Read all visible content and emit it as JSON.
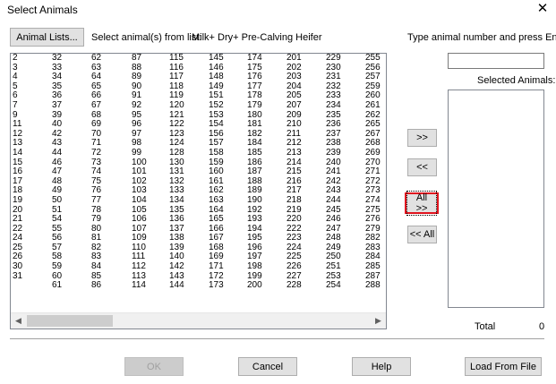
{
  "window": {
    "title": "Select Animals",
    "close_glyph": "✕"
  },
  "toolbar": {
    "animal_lists_label": "Animal Lists...",
    "instruction": "Select animal(s) from list:",
    "list_name": "Milk+ Dry+ Pre-Calving Heifer",
    "type_prompt": "Type animal number and press Enter"
  },
  "list": {
    "columns": [
      [
        "2",
        "3",
        "4",
        "5",
        "6",
        "7",
        "9",
        "11",
        "12",
        "13",
        "14",
        "15",
        "16",
        "17",
        "18",
        "19",
        "20",
        "21",
        "22",
        "24",
        "25",
        "26",
        "30",
        "31"
      ],
      [
        "32",
        "33",
        "34",
        "35",
        "36",
        "37",
        "39",
        "40",
        "42",
        "43",
        "44",
        "46",
        "47",
        "48",
        "49",
        "50",
        "51",
        "54",
        "55",
        "56",
        "57",
        "58",
        "59",
        "60",
        "61"
      ],
      [
        "62",
        "63",
        "64",
        "65",
        "66",
        "67",
        "68",
        "69",
        "70",
        "71",
        "72",
        "73",
        "74",
        "75",
        "76",
        "77",
        "78",
        "79",
        "80",
        "81",
        "82",
        "83",
        "84",
        "85",
        "86"
      ],
      [
        "87",
        "88",
        "89",
        "90",
        "91",
        "92",
        "95",
        "96",
        "97",
        "98",
        "99",
        "100",
        "101",
        "102",
        "103",
        "104",
        "105",
        "106",
        "107",
        "109",
        "110",
        "111",
        "112",
        "113",
        "114"
      ],
      [
        "115",
        "116",
        "117",
        "118",
        "119",
        "120",
        "121",
        "122",
        "123",
        "124",
        "128",
        "130",
        "131",
        "132",
        "133",
        "134",
        "135",
        "136",
        "137",
        "138",
        "139",
        "140",
        "142",
        "143",
        "144"
      ],
      [
        "145",
        "146",
        "148",
        "149",
        "151",
        "152",
        "153",
        "154",
        "156",
        "157",
        "158",
        "159",
        "160",
        "161",
        "162",
        "163",
        "164",
        "165",
        "166",
        "167",
        "168",
        "169",
        "171",
        "172",
        "173"
      ],
      [
        "174",
        "175",
        "176",
        "177",
        "178",
        "179",
        "180",
        "181",
        "182",
        "184",
        "185",
        "186",
        "187",
        "188",
        "189",
        "190",
        "192",
        "193",
        "194",
        "195",
        "196",
        "197",
        "198",
        "199",
        "200"
      ],
      [
        "201",
        "202",
        "203",
        "204",
        "205",
        "207",
        "209",
        "210",
        "211",
        "212",
        "213",
        "214",
        "215",
        "216",
        "217",
        "218",
        "219",
        "220",
        "222",
        "223",
        "224",
        "225",
        "226",
        "227",
        "228"
      ],
      [
        "229",
        "230",
        "231",
        "232",
        "233",
        "234",
        "235",
        "236",
        "237",
        "238",
        "239",
        "240",
        "241",
        "242",
        "243",
        "244",
        "245",
        "246",
        "247",
        "248",
        "249",
        "250",
        "251",
        "253",
        "254"
      ],
      [
        "255",
        "256",
        "257",
        "259",
        "260",
        "261",
        "262",
        "265",
        "267",
        "268",
        "269",
        "270",
        "271",
        "272",
        "273",
        "274",
        "275",
        "276",
        "279",
        "282",
        "283",
        "284",
        "285",
        "287",
        "288"
      ]
    ],
    "scroll_left_glyph": "◀",
    "scroll_right_glyph": "▶"
  },
  "transfer": {
    "add_label": ">>",
    "remove_label": "<<",
    "add_all_label": "All >>",
    "remove_all_label": "<< All"
  },
  "selected": {
    "heading": "Selected Animals:",
    "input_value": "",
    "total_label": "Total",
    "total_value": "0"
  },
  "footer": {
    "ok_label": "OK",
    "cancel_label": "Cancel",
    "help_label": "Help",
    "load_label": "Load From File"
  },
  "colors": {
    "highlight": "#e0141e",
    "button_face": "#e1e1e1"
  }
}
